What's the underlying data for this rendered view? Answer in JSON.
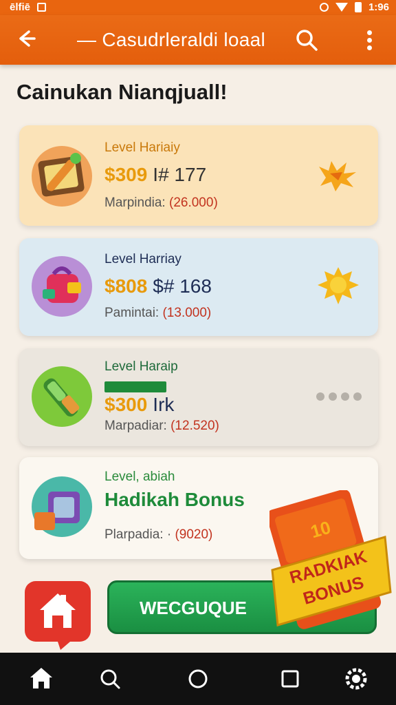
{
  "status": {
    "left_text": "ēlfiē",
    "time": "1:96"
  },
  "appbar": {
    "title": "— Casudrleraldi loaal",
    "back_icon": "arrow-left-icon",
    "search_icon": "search-icon",
    "more_icon": "more-vert-icon"
  },
  "page": {
    "heading": "Cainukan Nianqjuall!"
  },
  "cards": [
    {
      "level": "Level Hariaiy",
      "price": "$309",
      "extra": "I# 177",
      "sub_label": "Marpindia:",
      "sub_value": "(26.000)",
      "bg": "#fbe3b8",
      "level_color": "#c9790a",
      "right_icon": "sparkle-burst-icon"
    },
    {
      "level": "Level Harriay",
      "price": "$808",
      "extra": "$# 168",
      "sub_label": "Pamintai:",
      "sub_value": "(13.000)",
      "bg": "#dceaf2",
      "level_color": "#1e2d55",
      "right_icon": "sun-icon"
    },
    {
      "level": "Level Haraip",
      "price": "$300",
      "extra": "Irk",
      "sub_label": "Marpadiar:",
      "sub_value": "(12.520)",
      "bg": "#ebe6de",
      "level_color": "#1e6a3a",
      "right_icon": "dots-icon",
      "has_badge": true
    },
    {
      "level": "Level, abiah",
      "title": "Hadikah Bonus",
      "sub_label": "Plarpadia:  ·",
      "sub_value": "(9020)",
      "bg": "#fbf7f0",
      "level_color": "#2a8b3b"
    }
  ],
  "cta": {
    "label": "WECGUQUE"
  },
  "bonus_tag": {
    "line1": "RADKIAK",
    "line2": "BONUS",
    "corner": "10"
  },
  "home_badge": {
    "icon": "home-icon"
  },
  "nav": {
    "icons": [
      "home-icon",
      "search-icon",
      "circle-icon",
      "square-icon",
      "settings-icon"
    ]
  },
  "colors": {
    "primary": "#e9650f",
    "green": "#1e9a4a",
    "gold": "#f3c21a"
  }
}
